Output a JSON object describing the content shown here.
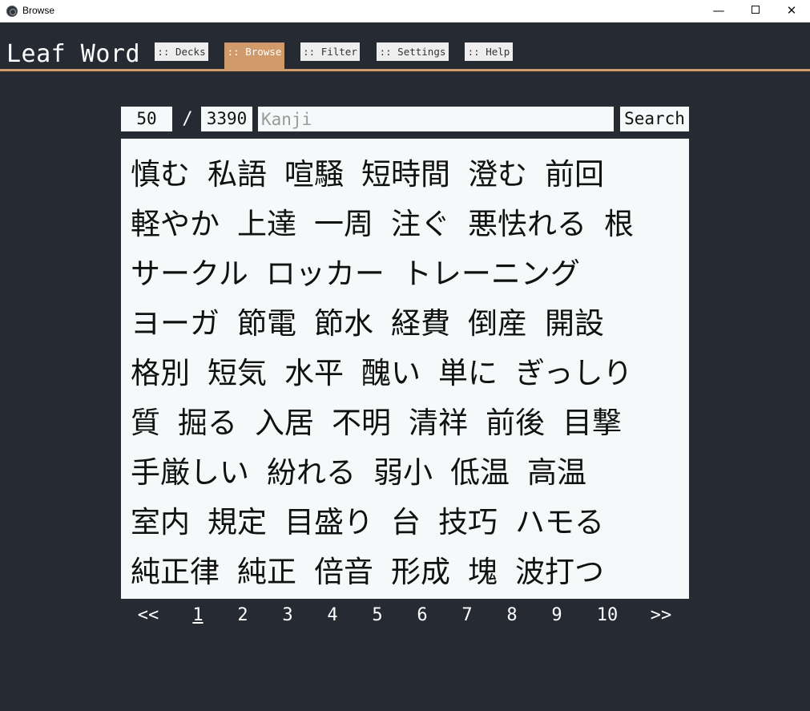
{
  "window": {
    "title": "Browse",
    "minimize_glyph": "—",
    "close_glyph": "✕"
  },
  "header": {
    "logo": "Leaf Word",
    "accent_color": "#d19a6b",
    "nav": [
      {
        "label": ":: Decks",
        "active": false
      },
      {
        "label": ":: Browse",
        "active": true
      },
      {
        "label": ":: Filter",
        "active": false
      },
      {
        "label": ":: Settings",
        "active": false
      },
      {
        "label": ":: Help",
        "active": false
      }
    ]
  },
  "search": {
    "per_page": "50",
    "separator": "/",
    "total": "3390",
    "placeholder": "Kanji",
    "value": "",
    "button_label": "Search"
  },
  "words": [
    "慎む",
    "私語",
    "喧騒",
    "短時間",
    "澄む",
    "前回",
    "軽やか",
    "上達",
    "一周",
    "注ぐ",
    "悪怯れる",
    "根",
    "サークル",
    "ロッカー",
    "トレーニング",
    "ヨーガ",
    "節電",
    "節水",
    "経費",
    "倒産",
    "開設",
    "格別",
    "短気",
    "水平",
    "醜い",
    "単に",
    "ぎっしり",
    "質",
    "掘る",
    "入居",
    "不明",
    "清祥",
    "前後",
    "目撃",
    "手厳しい",
    "紛れる",
    "弱小",
    "低温",
    "高温",
    "室内",
    "規定",
    "目盛り",
    "台",
    "技巧",
    "ハモる",
    "純正律",
    "純正",
    "倍音",
    "形成",
    "塊",
    "波打つ"
  ],
  "pagination": {
    "prev": "<<",
    "pages": [
      "1",
      "2",
      "3",
      "4",
      "5",
      "6",
      "7",
      "8",
      "9",
      "10"
    ],
    "current": "1",
    "next": ">>"
  }
}
